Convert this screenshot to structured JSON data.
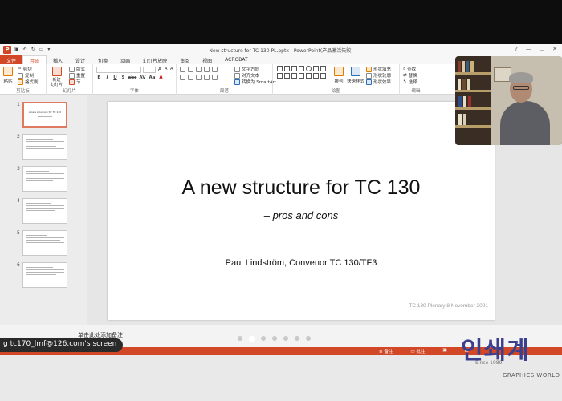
{
  "window": {
    "title": "New structure for TC 130 PL.pptx - PowerPoint(产品激活失败)"
  },
  "ribbon_tabs": [
    "文件",
    "开始",
    "插入",
    "设计",
    "切换",
    "动画",
    "幻灯片放映",
    "审阅",
    "视图",
    "ACROBAT"
  ],
  "ribbon": {
    "clipboard": {
      "paste": "粘贴",
      "cut": "剪切",
      "copy": "复制",
      "format_painter": "格式刷",
      "label": "剪贴板"
    },
    "slides": {
      "new_slide": "新建\n幻灯片",
      "layout": "版式",
      "reset": "重置",
      "section": "节",
      "label": "幻灯片"
    },
    "font": {
      "label": "字体",
      "format_buttons": [
        "B",
        "I",
        "U",
        "S",
        "abc",
        "AV",
        "Aa",
        "A"
      ]
    },
    "paragraph": {
      "text_direction": "文字方向",
      "align_text": "对齐文本",
      "smartart": "转换为 SmartArt",
      "label": "段落"
    },
    "drawing": {
      "arrange": "排列",
      "quick_styles": "快速样式",
      "shape_fill": "形状填充",
      "shape_outline": "形状轮廓",
      "shape_effects": "形状效果",
      "label": "绘图"
    },
    "editing": {
      "find": "查找",
      "replace": "替换",
      "select": "选择",
      "label": "编辑"
    }
  },
  "thumbnails": [
    {
      "num": "1",
      "title": "A new structure for TC 130",
      "selected": true
    },
    {
      "num": "2",
      "title": "",
      "selected": false
    },
    {
      "num": "3",
      "title": "",
      "selected": false
    },
    {
      "num": "4",
      "title": "",
      "selected": false
    },
    {
      "num": "5",
      "title": "",
      "selected": false
    },
    {
      "num": "6",
      "title": "",
      "selected": false
    }
  ],
  "slide": {
    "title": "A new structure for TC 130",
    "subtitle": "– pros and cons",
    "author": "Paul Lindström, Convenor TC 130/TF3",
    "footer": "TC 130 Plenary 8 November 2021"
  },
  "notes_placeholder": "单击此处添加备注",
  "statusbar": {
    "notes": "备注",
    "comments": "批注"
  },
  "share_label": "g tc170_lmf@126.com's screen",
  "watermark": {
    "main": "인쇄계",
    "since": "Since 1989",
    "brand": "GRAPHICS WORLD"
  },
  "colors": {
    "accent": "#d24726",
    "overlay_bg": "#0d0d0d"
  }
}
